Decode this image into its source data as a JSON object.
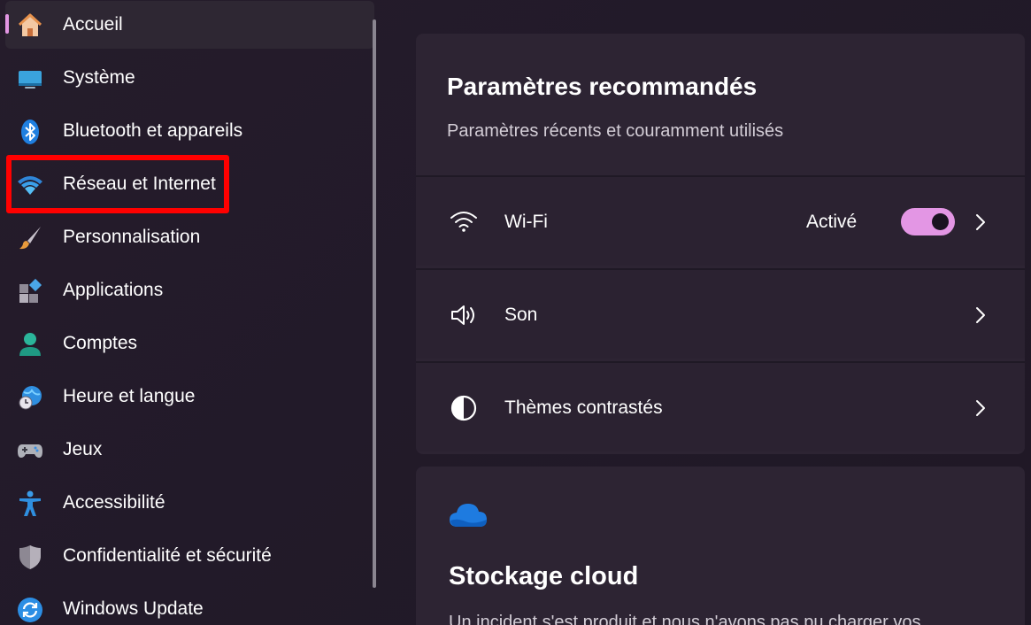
{
  "sidebar": {
    "items": [
      {
        "label": "Accueil",
        "icon": "home-icon",
        "active": true
      },
      {
        "label": "Système",
        "icon": "monitor-icon"
      },
      {
        "label": "Bluetooth et appareils",
        "icon": "bluetooth-icon"
      },
      {
        "label": "Réseau et Internet",
        "icon": "wifi-icon",
        "highlighted": true
      },
      {
        "label": "Personnalisation",
        "icon": "paintbrush-icon"
      },
      {
        "label": "Applications",
        "icon": "apps-icon"
      },
      {
        "label": "Comptes",
        "icon": "user-icon"
      },
      {
        "label": "Heure et langue",
        "icon": "globe-clock-icon"
      },
      {
        "label": "Jeux",
        "icon": "gamepad-icon"
      },
      {
        "label": "Accessibilité",
        "icon": "accessibility-icon"
      },
      {
        "label": "Confidentialité et sécurité",
        "icon": "shield-icon"
      },
      {
        "label": "Windows Update",
        "icon": "update-icon"
      }
    ]
  },
  "recommended": {
    "title": "Paramètres recommandés",
    "subtitle": "Paramètres récents et couramment utilisés",
    "rows": [
      {
        "label": "Wi-Fi",
        "icon": "wifi-icon",
        "status": "Activé",
        "toggle_on": true
      },
      {
        "label": "Son",
        "icon": "speaker-icon"
      },
      {
        "label": "Thèmes contrastés",
        "icon": "contrast-icon"
      }
    ]
  },
  "cloud": {
    "title": "Stockage cloud",
    "text": "Un incident s'est produit et nous n'avons pas pu charger vos",
    "icon": "cloud-icon"
  },
  "colors": {
    "accent": "#e396e4",
    "highlight_border": "#ff0000",
    "background": "#221a29",
    "card": "#2d2433"
  }
}
